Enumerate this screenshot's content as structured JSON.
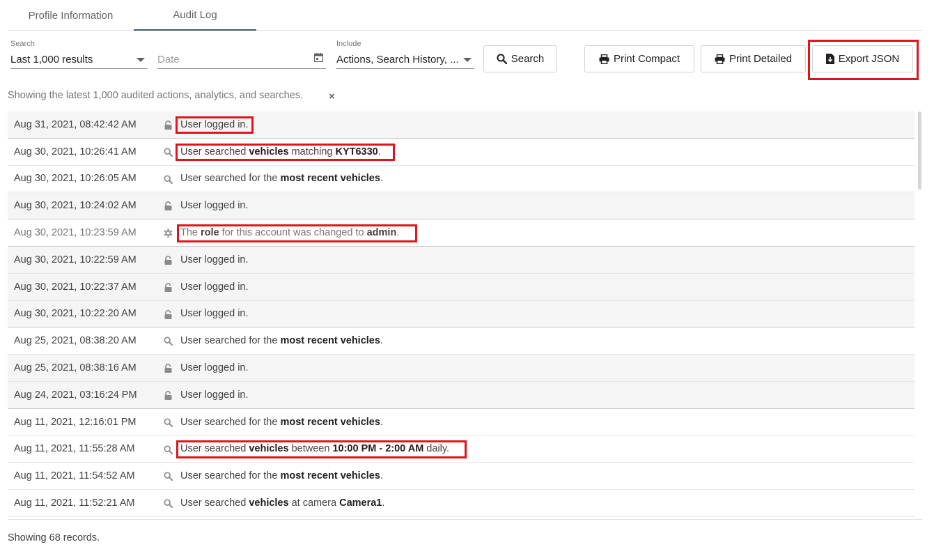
{
  "tabs": [
    {
      "label": "Profile Information"
    },
    {
      "label": "Audit Log"
    }
  ],
  "filters": {
    "search": {
      "label": "Search",
      "value": "Last 1,000 results"
    },
    "date": {
      "placeholder": "Date"
    },
    "include": {
      "label": "Include",
      "value": "Actions, Search History, ..."
    }
  },
  "buttons": {
    "search": "Search",
    "print_compact": "Print Compact",
    "print_detailed": "Print Detailed",
    "export_json": "Export JSON"
  },
  "info_text": "Showing the latest 1,000 audited actions, analytics, and searches.",
  "clear_glyph": "×",
  "footer": "Showing 68 records.",
  "rows": [
    {
      "time": "Aug 31, 2021, 08:42:42 AM",
      "icon": "lock-icon",
      "msg": [
        {
          "t": "User logged in."
        }
      ]
    },
    {
      "time": "Aug 30, 2021, 10:26:41 AM",
      "icon": "search-icon",
      "msg": [
        {
          "t": "User searched "
        },
        {
          "t": "vehicles",
          "b": 1
        },
        {
          "t": " matching "
        },
        {
          "t": "KYT6330",
          "b": 1
        },
        {
          "t": "."
        }
      ]
    },
    {
      "time": "Aug 30, 2021, 10:26:05 AM",
      "icon": "search-icon",
      "msg": [
        {
          "t": "User searched for the "
        },
        {
          "t": "most recent vehicles",
          "b": 1
        },
        {
          "t": "."
        }
      ]
    },
    {
      "time": "Aug 30, 2021, 10:24:02 AM",
      "icon": "lock-icon",
      "msg": [
        {
          "t": "User logged in."
        }
      ]
    },
    {
      "time": "Aug 30, 2021, 10:23:59 AM",
      "icon": "gear-icon",
      "msg": [
        {
          "t": "The "
        },
        {
          "t": "role",
          "b": 1
        },
        {
          "t": " for this account was changed to "
        },
        {
          "t": "admin",
          "b": 1
        },
        {
          "t": "."
        }
      ]
    },
    {
      "time": "Aug 30, 2021, 10:22:59 AM",
      "icon": "lock-icon",
      "msg": [
        {
          "t": "User logged in."
        }
      ]
    },
    {
      "time": "Aug 30, 2021, 10:22:37 AM",
      "icon": "lock-icon",
      "msg": [
        {
          "t": "User logged in."
        }
      ]
    },
    {
      "time": "Aug 30, 2021, 10:22:20 AM",
      "icon": "lock-icon",
      "msg": [
        {
          "t": "User logged in."
        }
      ]
    },
    {
      "time": "Aug 25, 2021, 08:38:20 AM",
      "icon": "search-icon",
      "msg": [
        {
          "t": "User searched for the "
        },
        {
          "t": "most recent vehicles",
          "b": 1
        },
        {
          "t": "."
        }
      ]
    },
    {
      "time": "Aug 25, 2021, 08:38:16 AM",
      "icon": "lock-icon",
      "msg": [
        {
          "t": "User logged in."
        }
      ]
    },
    {
      "time": "Aug 24, 2021, 03:16:24 PM",
      "icon": "lock-icon",
      "msg": [
        {
          "t": "User logged in."
        }
      ]
    },
    {
      "time": "Aug 11, 2021, 12:16:01 PM",
      "icon": "search-icon",
      "msg": [
        {
          "t": "User searched for the "
        },
        {
          "t": "most recent vehicles",
          "b": 1
        },
        {
          "t": "."
        }
      ]
    },
    {
      "time": "Aug 11, 2021, 11:55:28 AM",
      "icon": "search-icon",
      "msg": [
        {
          "t": "User searched "
        },
        {
          "t": "vehicles",
          "b": 1
        },
        {
          "t": " between "
        },
        {
          "t": "10:00 PM - 2:00 AM",
          "b": 1
        },
        {
          "t": " daily."
        }
      ]
    },
    {
      "time": "Aug 11, 2021, 11:54:52 AM",
      "icon": "search-icon",
      "msg": [
        {
          "t": "User searched for the "
        },
        {
          "t": "most recent vehicles",
          "b": 1
        },
        {
          "t": "."
        }
      ]
    },
    {
      "time": "Aug 11, 2021, 11:52:21 AM",
      "icon": "search-icon",
      "msg": [
        {
          "t": "User searched "
        },
        {
          "t": "vehicles",
          "b": 1
        },
        {
          "t": " at camera "
        },
        {
          "t": "Camera1",
          "b": 1
        },
        {
          "t": "."
        }
      ]
    }
  ],
  "colors": {
    "highlight": "#e0141e",
    "active_tab": "#455a64",
    "row_alt": "#f5f5f5"
  }
}
